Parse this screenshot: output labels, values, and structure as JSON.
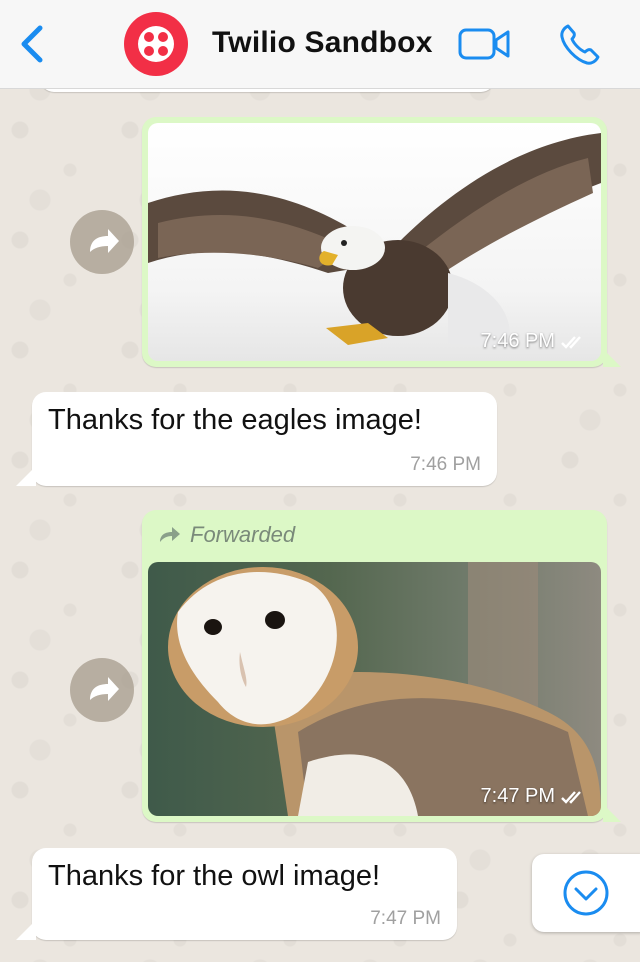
{
  "header": {
    "back_icon": "chevron-left-icon",
    "avatar_icon": "twilio-logo-icon",
    "title": "Twilio Sandbox",
    "video_icon": "video-call-icon",
    "phone_icon": "phone-call-icon",
    "accent": "#1a8cf0",
    "brand": "#f22f46"
  },
  "messages": [
    {
      "type": "outgoing-image",
      "image": "bald eagle",
      "time": "7:46 PM",
      "status_icon": "double-check-icon"
    },
    {
      "type": "incoming-text",
      "text": "Thanks for the eagles image!",
      "time": "7:46 PM"
    },
    {
      "type": "outgoing-image",
      "forwarded_label": "Forwarded",
      "image": "barn owl",
      "time": "7:47 PM",
      "status_icon": "double-check-icon"
    },
    {
      "type": "incoming-text",
      "text": "Thanks for the owl image!",
      "time": "7:47 PM"
    }
  ],
  "scroll_button_icon": "chevron-down-circle-icon"
}
